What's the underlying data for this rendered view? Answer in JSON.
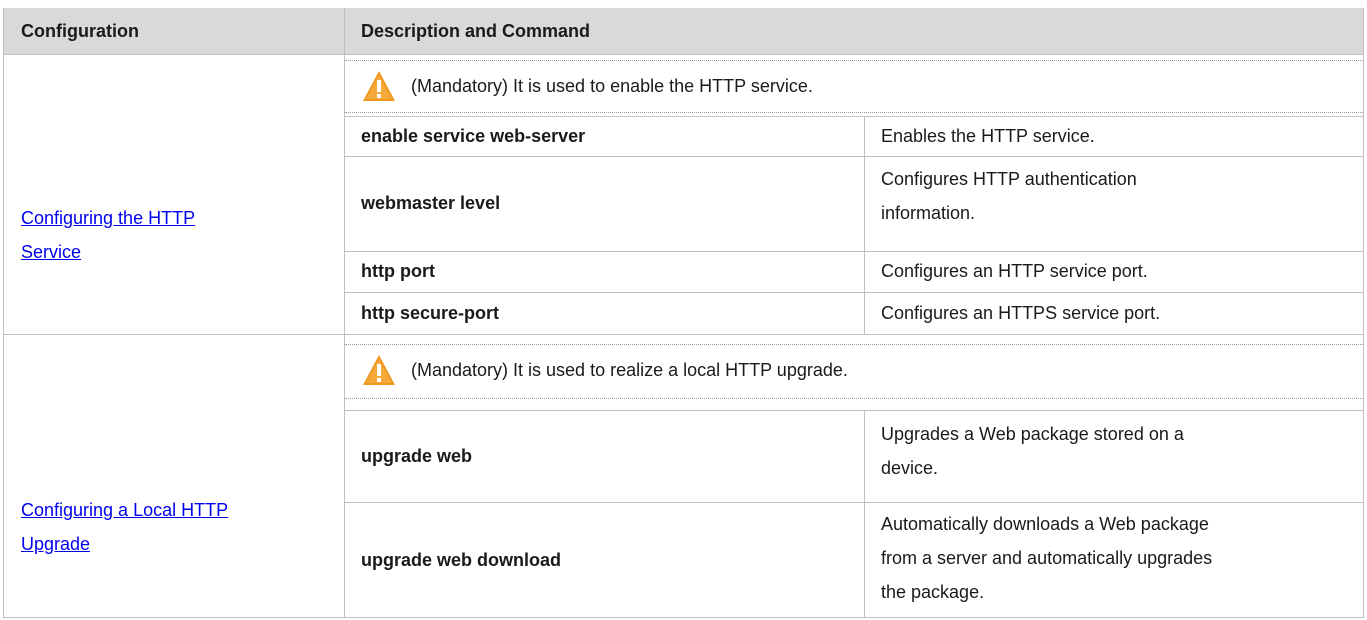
{
  "header": {
    "configuration": "Configuration",
    "description": "Description and Command"
  },
  "groups": [
    {
      "link_line1": "Configuring the HTTP ",
      "link_line2": "Service",
      "note": "(Mandatory) It is used to enable the HTTP service.",
      "rows": [
        {
          "command": "enable service web-server",
          "description_lines": [
            "Enables the HTTP service."
          ]
        },
        {
          "command": "webmaster level",
          "description_lines": [
            "Configures HTTP authentication",
            "information."
          ]
        },
        {
          "command": "http port",
          "description_lines": [
            "Configures an HTTP service port."
          ]
        },
        {
          "command": "http secure-port",
          "description_lines": [
            "Configures an HTTPS service port."
          ]
        }
      ]
    },
    {
      "link_line1": "Configuring a Local HTTP ",
      "link_line2": "Upgrade",
      "note": "(Mandatory) It is used to realize a local HTTP upgrade.",
      "rows": [
        {
          "command": "upgrade web",
          "description_lines": [
            "Upgrades a Web package stored on a",
            "device."
          ]
        },
        {
          "command": "upgrade web download",
          "description_lines": [
            "Automatically downloads a Web package",
            "from a server and automatically upgrades",
            "the package."
          ]
        }
      ]
    }
  ],
  "colors": {
    "header_bg": "#d9d9d9",
    "border": "#bfbfbf",
    "link": "#0000ee",
    "warning": "#f0961e"
  }
}
